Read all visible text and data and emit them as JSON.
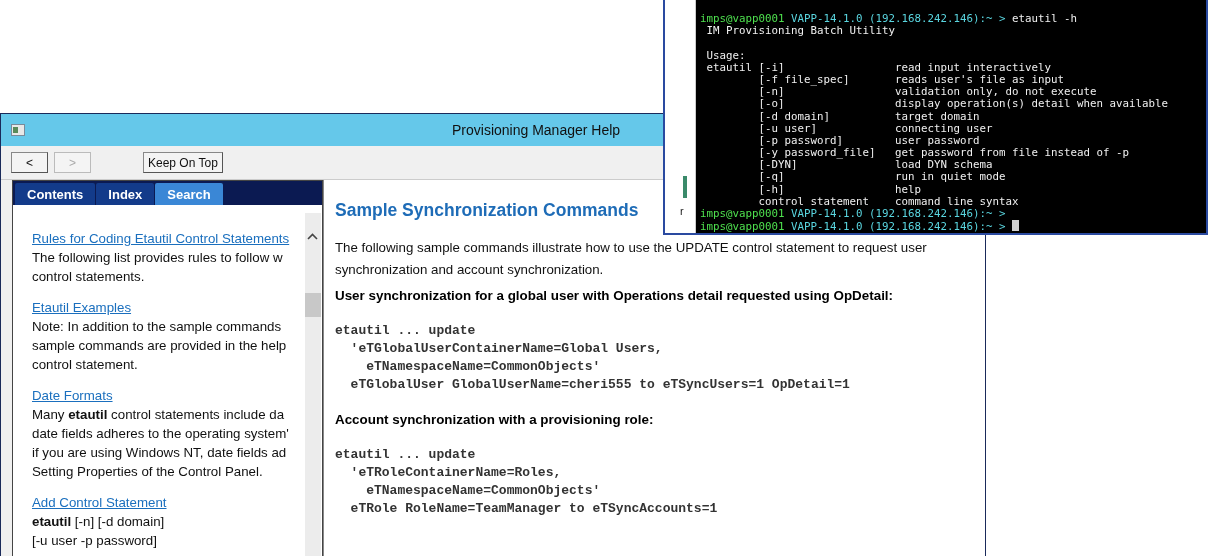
{
  "help_window": {
    "title": "Provisioning Manager Help",
    "nav_buttons": [
      {
        "label": "<",
        "disabled": false
      },
      {
        "label": ">",
        "disabled": true
      }
    ],
    "keep_on_top": "Keep On Top",
    "tabs": [
      {
        "label": "Contents",
        "selected": false
      },
      {
        "label": "Index",
        "selected": false
      },
      {
        "label": "Search",
        "selected": true
      }
    ],
    "results": [
      {
        "link": "Rules for Coding Etautil Control Statements",
        "lines": [
          "The following list provides rules to follow w",
          "control statements."
        ]
      },
      {
        "link": "Etautil Examples",
        "lines": [
          "Note: In addition to the sample commands",
          "sample commands are provided in the help",
          "control statement."
        ]
      },
      {
        "link": "Date Formats",
        "lines": [
          "Many **etautil** control statements include da",
          "date fields adheres to the operating system'",
          "if you are using Windows NT, date fields ad",
          "Setting Properties of the Control Panel."
        ]
      },
      {
        "link": "Add Control Statement",
        "lines": [
          "**etautil** [-n] [-d domain]",
          "[-u user -p password]"
        ]
      }
    ],
    "article": {
      "heading": "Sample Synchronization Commands",
      "intro": [
        "The following sample commands illustrate how to use the UPDATE control statement to request user",
        "synchronization and account synchronization."
      ],
      "examples": [
        {
          "caption": "User synchronization for a global user with Operations detail requested using OpDetail:",
          "code": [
            "etautil ... update",
            "  'eTGlobalUserContainerName=Global Users,",
            "    eTNamespaceName=CommonObjects'",
            "  eTGlobalUser GlobalUserName=cheri555 to eTSyncUsers=1 OpDetail=1"
          ]
        },
        {
          "caption": "Account synchronization with a provisioning role:",
          "code": [
            "etautil ... update",
            "  'eTRoleContainerName=Roles,",
            "    eTNamespaceName=CommonObjects'",
            "  eTRole RoleName=TeamManager to eTSyncAccounts=1"
          ]
        }
      ]
    }
  },
  "terminal": {
    "side_char": "r",
    "lines": [
      {
        "kind": "prompt",
        "user": "imps@vapp0001",
        "host": "VAPP-14.1.0 (192.168.242.146):~ >",
        "command": "etautil -h"
      },
      {
        "kind": "output",
        "text": " IM Provisioning Batch Utility"
      },
      {
        "kind": "blank"
      },
      {
        "kind": "output",
        "text": " Usage:"
      },
      {
        "kind": "output",
        "text": " etautil [-i]                 read input interactively"
      },
      {
        "kind": "output",
        "text": "         [-f file_spec]       reads user's file as input"
      },
      {
        "kind": "output",
        "text": "         [-n]                 validation only, do not execute"
      },
      {
        "kind": "output",
        "text": "         [-o]                 display operation(s) detail when available"
      },
      {
        "kind": "output",
        "text": "         [-d domain]          target domain"
      },
      {
        "kind": "output",
        "text": "         [-u user]            connecting user"
      },
      {
        "kind": "output",
        "text": "         [-p password]        user password"
      },
      {
        "kind": "output",
        "text": "         [-y password_file]   get password from file instead of -p"
      },
      {
        "kind": "output",
        "text": "         [-DYN]               load DYN schema"
      },
      {
        "kind": "output",
        "text": "         [-q]                 run in quiet mode"
      },
      {
        "kind": "output",
        "text": "         [-h]                 help"
      },
      {
        "kind": "output",
        "text": "         control statement    command line syntax"
      },
      {
        "kind": "prompt",
        "user": "imps@vapp0001",
        "host": "VAPP-14.1.0 (192.168.242.146):~ >"
      },
      {
        "kind": "prompt",
        "user": "imps@vapp0001",
        "host": "VAPP-14.1.0 (192.168.242.146):~ >",
        "cursor": true
      }
    ]
  }
}
